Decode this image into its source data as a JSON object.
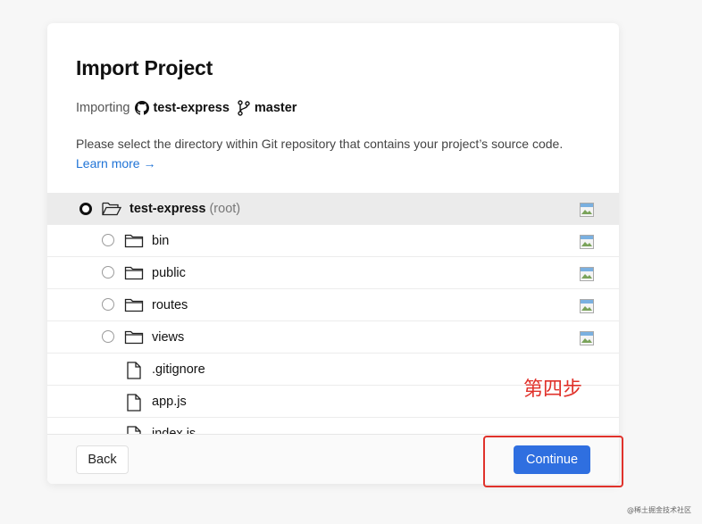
{
  "dialog": {
    "title": "Import Project",
    "importing_label": "Importing",
    "repo_name": "test-express",
    "branch": "master",
    "description": "Please select the directory within Git repository that contains your project’s source code.",
    "learn_more": "Learn more →"
  },
  "tree": [
    {
      "name": "test-express",
      "suffix": "(root)",
      "type": "folder-open",
      "selected": true,
      "has_radio": true
    },
    {
      "name": "bin",
      "type": "folder",
      "selected": false,
      "has_radio": true
    },
    {
      "name": "public",
      "type": "folder",
      "selected": false,
      "has_radio": true
    },
    {
      "name": "routes",
      "type": "folder",
      "selected": false,
      "has_radio": true
    },
    {
      "name": "views",
      "type": "folder",
      "selected": false,
      "has_radio": true
    },
    {
      "name": ".gitignore",
      "type": "file",
      "has_radio": false
    },
    {
      "name": "app.js",
      "type": "file",
      "has_radio": false
    },
    {
      "name": "index.js",
      "type": "file",
      "has_radio": false
    }
  ],
  "footer": {
    "back_label": "Back",
    "continue_label": "Continue"
  },
  "annotation": {
    "text": "第四步",
    "color": "#e0322b"
  },
  "watermark": "@稀土掘金技术社区",
  "colors": {
    "primary": "#2f6fe0",
    "link": "#1f73d6",
    "selected_row": "#ebebeb"
  }
}
